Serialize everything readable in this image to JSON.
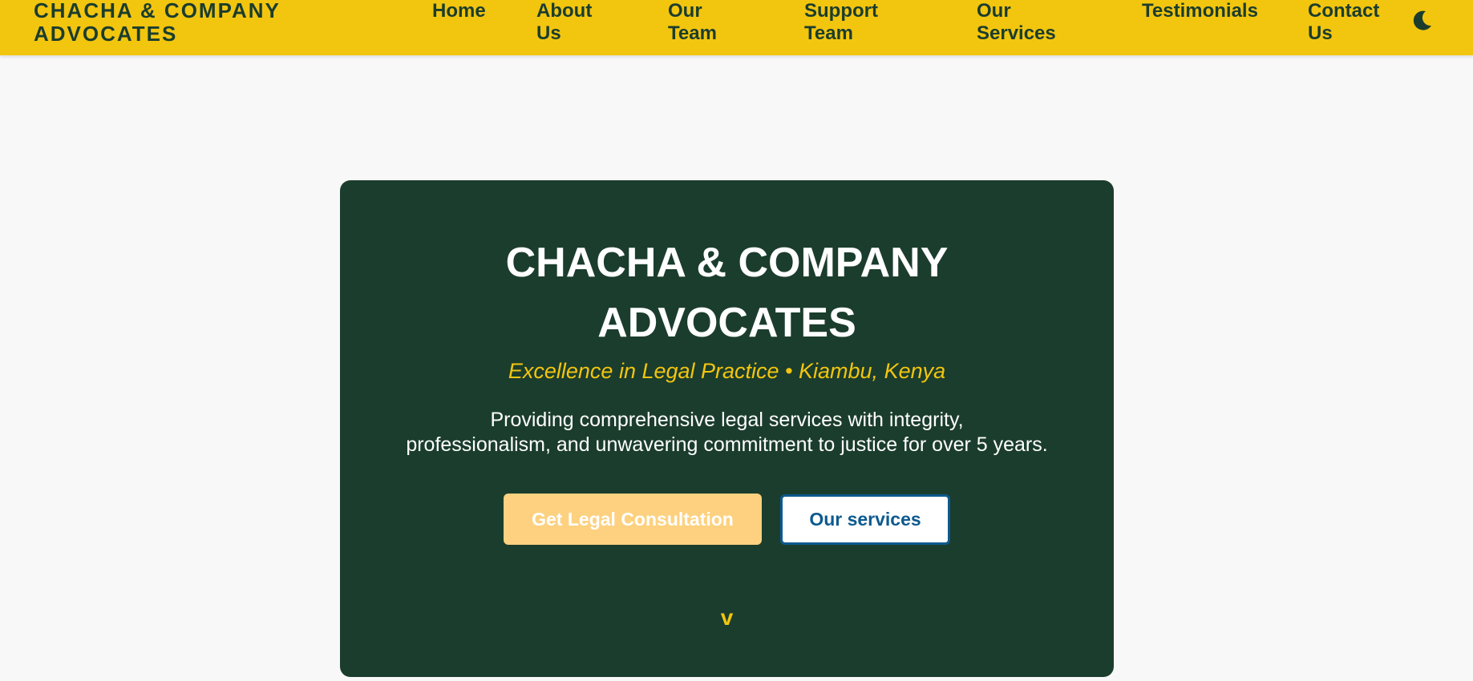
{
  "colors": {
    "header_bg": "#f2c50f",
    "brand_dark": "#1b3d2d",
    "page_bg": "#f8f8f8",
    "accent_yellow": "#f2c50f",
    "primary_button_bg": "#fdd17f",
    "secondary_button_border": "#0d5a8f"
  },
  "header": {
    "logo_line1": "CHACHA & COMPANY",
    "logo_line2": "ADVOCATES",
    "nav": [
      {
        "line1": "Home",
        "line2": ""
      },
      {
        "line1": "About",
        "line2": "Us"
      },
      {
        "line1": "Our",
        "line2": "Team"
      },
      {
        "line1": "Support",
        "line2": "Team"
      },
      {
        "line1": "Our",
        "line2": "Services"
      },
      {
        "line1": "Testimonials",
        "line2": ""
      },
      {
        "line1": "Contact",
        "line2": "Us"
      }
    ],
    "theme_toggle_icon": "moon-icon"
  },
  "hero": {
    "title_line1": "CHACHA & COMPANY",
    "title_line2": "ADVOCATES",
    "tagline": "Excellence in Legal Practice • Kiambu, Kenya",
    "description_line1": "Providing comprehensive legal services with integrity,",
    "description_line2": "professionalism, and unwavering commitment to justice for over 5 years.",
    "primary_button": "Get Legal Consultation",
    "secondary_button": "Our services",
    "scroll_indicator": "v"
  }
}
